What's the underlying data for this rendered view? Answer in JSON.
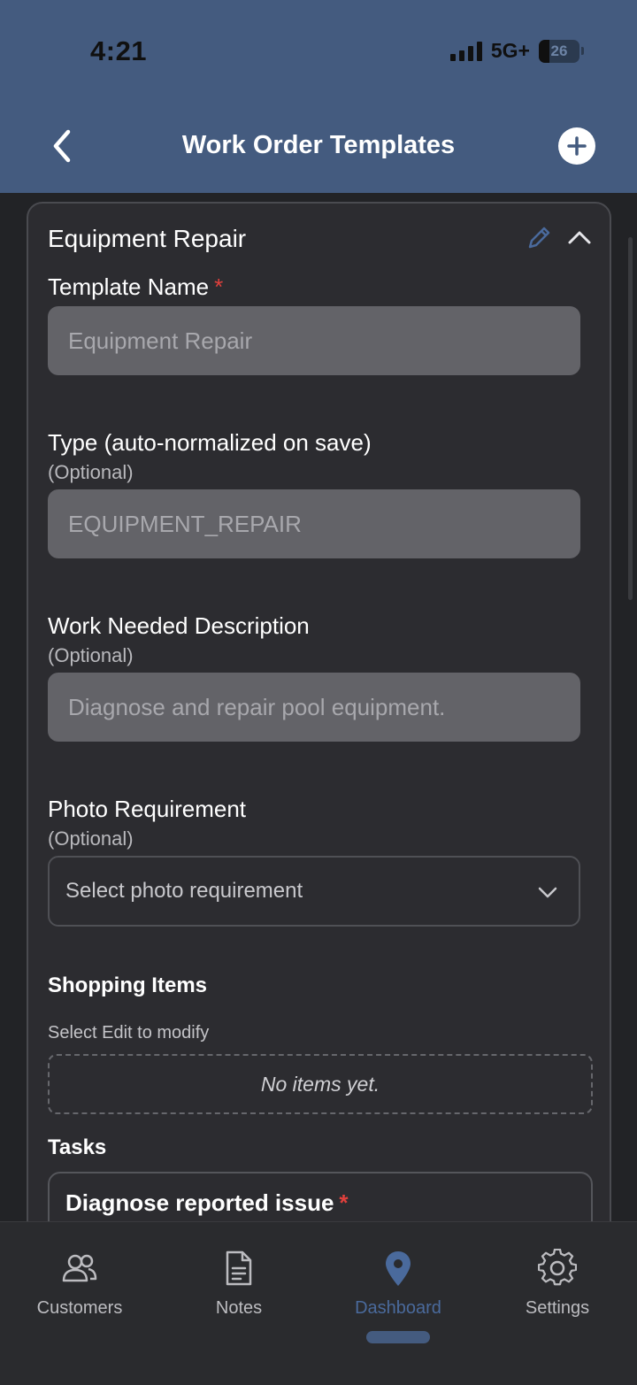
{
  "status_bar": {
    "time": "4:21",
    "network": "5G+",
    "battery": "26"
  },
  "header": {
    "title": "Work Order Templates",
    "icons": {
      "back": "chevron-left-icon",
      "add": "plus-circle-icon"
    }
  },
  "card": {
    "title": "Equipment Repair",
    "icons": {
      "edit": "pencil-icon",
      "collapse": "chevron-up-icon"
    },
    "template_name": {
      "label": "Template Name",
      "required_mark": "*",
      "value": "Equipment Repair"
    },
    "type": {
      "label": "Type (auto-normalized on save)",
      "optional": "(Optional)",
      "value": "EQUIPMENT_REPAIR"
    },
    "work_needed": {
      "label": "Work Needed Description",
      "optional": "(Optional)",
      "value": "Diagnose and repair pool equipment."
    },
    "photo": {
      "label": "Photo Requirement",
      "optional": "(Optional)",
      "placeholder": "Select photo requirement"
    },
    "shopping": {
      "title": "Shopping Items",
      "hint": "Select Edit to modify",
      "empty": "No items yet."
    },
    "tasks": {
      "title": "Tasks",
      "items": [
        {
          "label": "Diagnose reported issue",
          "required_mark": "*"
        }
      ]
    }
  },
  "tabbar": {
    "tabs": [
      {
        "label": "Customers",
        "icon": "users-icon"
      },
      {
        "label": "Notes",
        "icon": "document-icon"
      },
      {
        "label": "Dashboard",
        "icon": "map-pin-icon",
        "active": true
      },
      {
        "label": "Settings",
        "icon": "gear-icon"
      }
    ]
  },
  "colors": {
    "header_bg": "#445b7f",
    "accent": "#4a6a9c",
    "required": "#e0403c",
    "background": "#222326"
  }
}
